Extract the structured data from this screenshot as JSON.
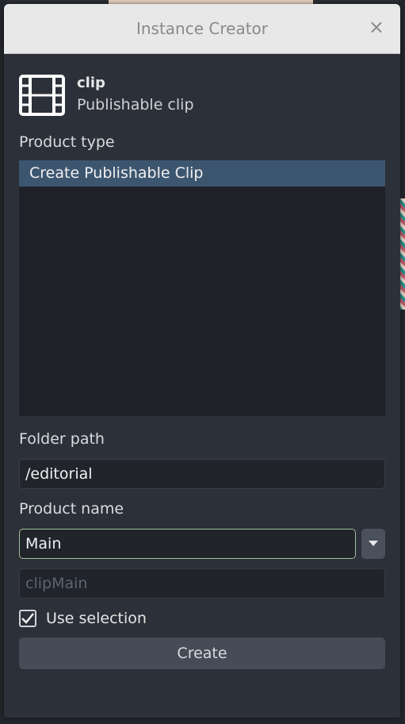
{
  "window": {
    "title": "Instance Creator",
    "close_glyph": "×"
  },
  "creator": {
    "product_type": "clip",
    "product_description": "Publishable clip",
    "icon": "film-icon"
  },
  "product_type_section": {
    "label": "Product type",
    "items": [
      "Create Publishable Clip"
    ],
    "selected_index": 0
  },
  "folder_path": {
    "label": "Folder path",
    "value": "/editorial"
  },
  "product_name": {
    "label": "Product name",
    "value": "Main",
    "dropdown_icon": "chevron-down-icon",
    "preview": "clipMain"
  },
  "use_selection": {
    "label": "Use selection",
    "checked": true
  },
  "create_button": {
    "label": "Create"
  },
  "colors": {
    "selection": "#3d5670",
    "focus_border": "#9ec19e",
    "panel": "#2c3038"
  }
}
